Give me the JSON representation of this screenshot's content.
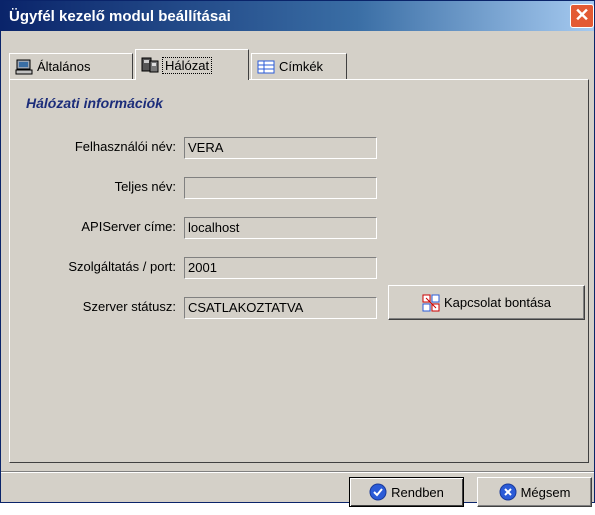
{
  "window": {
    "title": "Ügyfél kezelő modul beállításai",
    "close_glyph": "✕"
  },
  "tabs": [
    {
      "label": "Általános",
      "icon": "computer-icon",
      "active": false
    },
    {
      "label": "Hálózat",
      "icon": "network-icon",
      "active": true
    },
    {
      "label": "Címkék",
      "icon": "labels-icon",
      "active": false
    }
  ],
  "section": {
    "title": "Hálózati információk"
  },
  "fields": [
    {
      "label": "Felhasználói név:",
      "value": "VERA"
    },
    {
      "label": "Teljes név:",
      "value": ""
    },
    {
      "label": "APIServer címe:",
      "value": "localhost"
    },
    {
      "label": "Szolgáltatás / port:",
      "value": "2001"
    },
    {
      "label": "Szerver státusz:",
      "value": "CSATLAKOZTATVA"
    }
  ],
  "disconnect_button": {
    "label": "Kapcsolat bontása",
    "icon": "disconnect-icon"
  },
  "footer": {
    "ok_label": "Rendben",
    "ok_icon": "check-icon",
    "cancel_label": "Mégsem",
    "cancel_icon": "cancel-icon"
  },
  "colors": {
    "titlebar_start": "#0a246a",
    "titlebar_end": "#a6caf0",
    "close_button": "#e35a34",
    "section_title": "#1c2d7a",
    "window_bg": "#d4d0c8",
    "icon_blue": "#2b5bd7"
  }
}
